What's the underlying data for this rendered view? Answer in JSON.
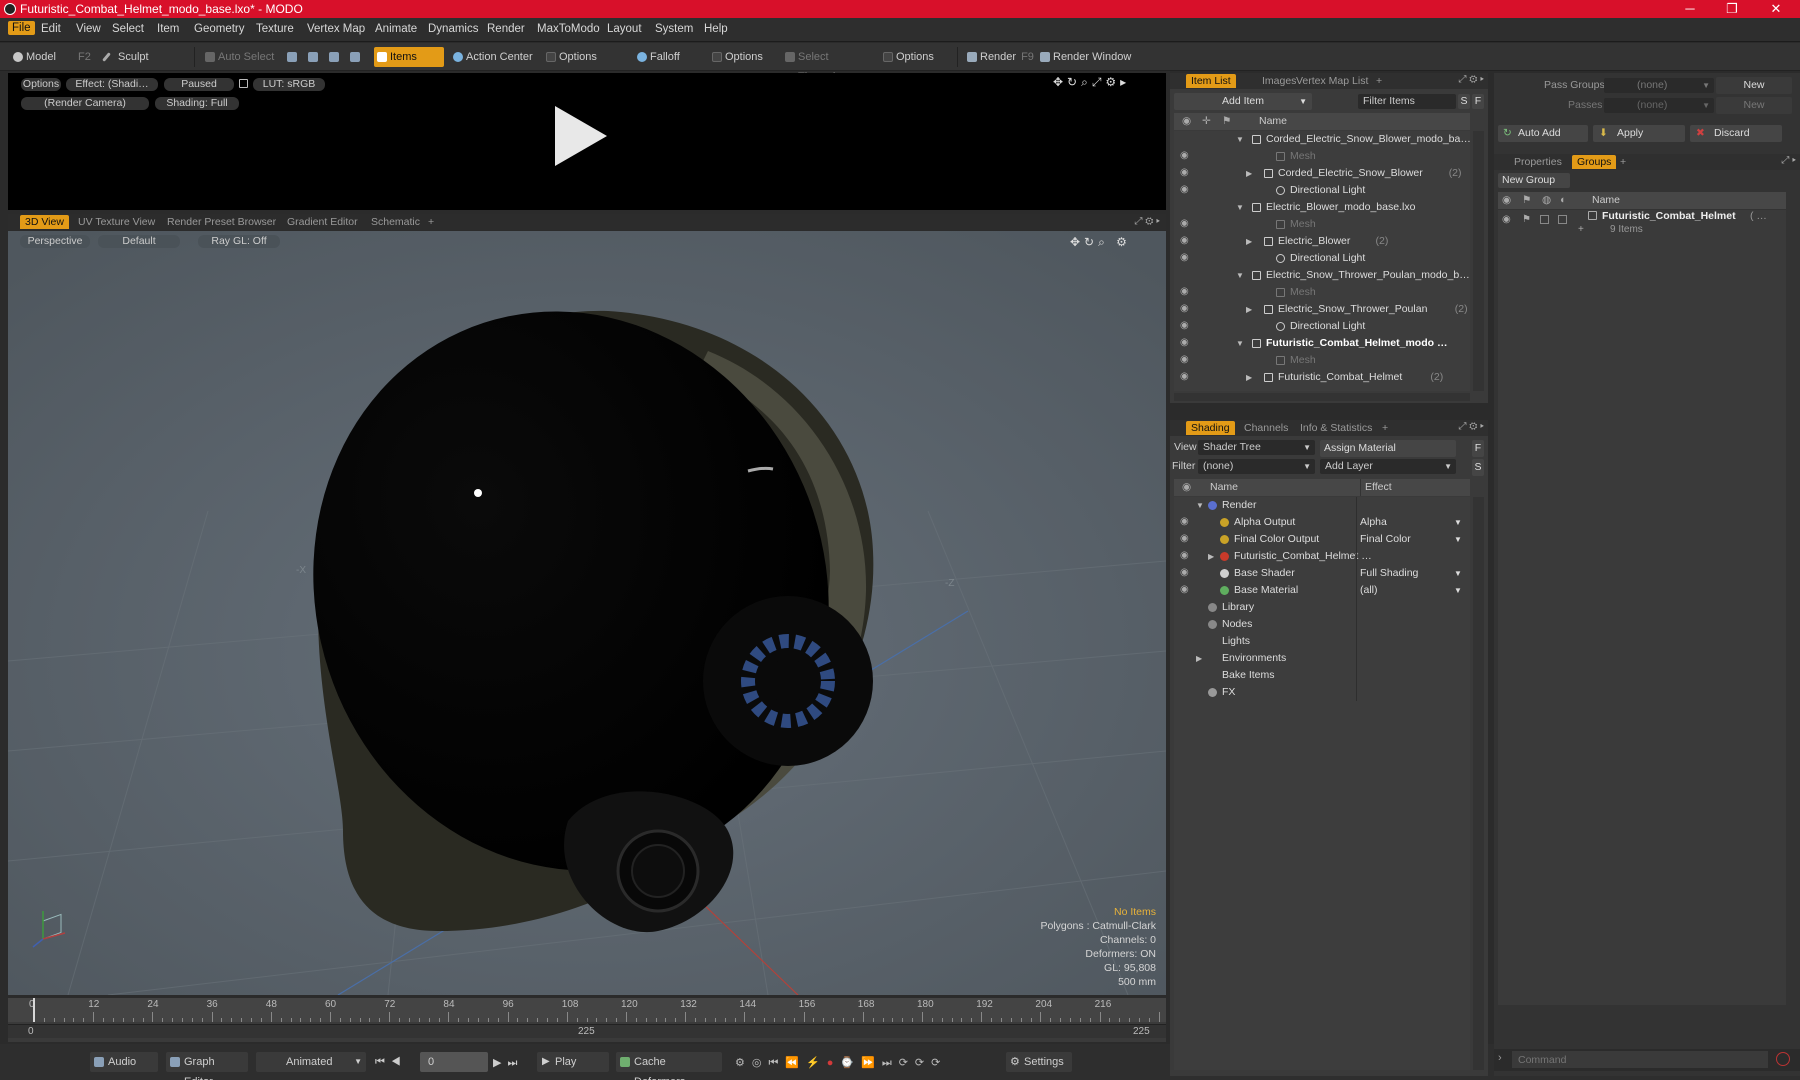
{
  "window": {
    "title": "Futuristic_Combat_Helmet_modo_base.lxo* - MODO",
    "minimize": "─",
    "maximize": "❐",
    "close": "✕"
  },
  "menu": [
    "File",
    "Edit",
    "View",
    "Select",
    "Item",
    "Geometry",
    "Texture",
    "Vertex Map",
    "Animate",
    "Dynamics",
    "Render",
    "MaxToModo",
    "Layout",
    "System",
    "Help"
  ],
  "toolbar": {
    "model": "Model",
    "model_key": "F2",
    "sculpt": "Sculpt",
    "auto_select": "Auto Select",
    "items": "Items",
    "action_center": "Action Center",
    "options1": "Options",
    "falloff": "Falloff",
    "options2": "Options",
    "select_through": "Select Through",
    "options3": "Options",
    "render": "Render",
    "render_key": "F9",
    "render_window": "Render Window"
  },
  "preview": {
    "options": "Options",
    "effect": "Effect: (Shadi…",
    "paused": "Paused",
    "lut": "LUT: sRGB",
    "camera": "(Render Camera)",
    "shading": "Shading: Full"
  },
  "viewtabs": [
    "3D View",
    "UV Texture View",
    "Render Preset Browser",
    "Gradient Editor",
    "Schematic",
    "+"
  ],
  "viewport": {
    "perspective": "Perspective",
    "default": "Default",
    "raygl": "Ray GL: Off",
    "axis_neg_x": "-X",
    "axis_neg_z": "-Z",
    "hud": {
      "no_items": "No Items",
      "polygons": "Polygons : Catmull-Clark",
      "channels": "Channels: 0",
      "deformers": "Deformers: ON",
      "gl": "GL: 95,808",
      "scale": "500 mm"
    }
  },
  "timeline": {
    "labels": [
      "0",
      "12",
      "24",
      "36",
      "48",
      "60",
      "72",
      "84",
      "96",
      "108",
      "120",
      "132",
      "144",
      "156",
      "168",
      "180",
      "192",
      "204",
      "216"
    ],
    "range_start": "0",
    "range_mid": "225",
    "range_end": "225"
  },
  "bottom": {
    "audio": "Audio",
    "graph_editor": "Graph Editor",
    "animated": "Animated",
    "frame": "0",
    "play": "Play",
    "cache_deformers": "Cache Deformers",
    "settings": "Settings"
  },
  "itemlist": {
    "tabs": [
      "Item List",
      "Images",
      "Vertex Map List",
      "+"
    ],
    "add_item": "Add Item",
    "filter": "Filter Items",
    "col_name": "Name",
    "s": "S",
    "f": "F",
    "rows": [
      {
        "label": "Corded_Electric_Snow_Blower_modo_ba…",
        "indent": 0,
        "type": "scene",
        "arrow": "▼",
        "bold": false,
        "dim": false,
        "count": ""
      },
      {
        "label": "Mesh",
        "indent": 2,
        "type": "mesh",
        "arrow": "",
        "bold": false,
        "dim": true,
        "count": ""
      },
      {
        "label": "Corded_Electric_Snow_Blower",
        "indent": 1,
        "type": "group",
        "arrow": "▶",
        "bold": false,
        "dim": false,
        "count": "(2)"
      },
      {
        "label": "Directional Light",
        "indent": 2,
        "type": "light",
        "arrow": "",
        "bold": false,
        "dim": false,
        "count": ""
      },
      {
        "label": "Electric_Blower_modo_base.lxo",
        "indent": 0,
        "type": "scene",
        "arrow": "▼",
        "bold": false,
        "dim": false,
        "count": ""
      },
      {
        "label": "Mesh",
        "indent": 2,
        "type": "mesh",
        "arrow": "",
        "bold": false,
        "dim": true,
        "count": ""
      },
      {
        "label": "Electric_Blower",
        "indent": 1,
        "type": "group",
        "arrow": "▶",
        "bold": false,
        "dim": false,
        "count": "(2)"
      },
      {
        "label": "Directional Light",
        "indent": 2,
        "type": "light",
        "arrow": "",
        "bold": false,
        "dim": false,
        "count": ""
      },
      {
        "label": "Electric_Snow_Thrower_Poulan_modo_b…",
        "indent": 0,
        "type": "scene",
        "arrow": "▼",
        "bold": false,
        "dim": false,
        "count": ""
      },
      {
        "label": "Mesh",
        "indent": 2,
        "type": "mesh",
        "arrow": "",
        "bold": false,
        "dim": true,
        "count": ""
      },
      {
        "label": "Electric_Snow_Thrower_Poulan",
        "indent": 1,
        "type": "group",
        "arrow": "▶",
        "bold": false,
        "dim": false,
        "count": "(2)"
      },
      {
        "label": "Directional Light",
        "indent": 2,
        "type": "light",
        "arrow": "",
        "bold": false,
        "dim": false,
        "count": ""
      },
      {
        "label": "Futuristic_Combat_Helmet_modo …",
        "indent": 0,
        "type": "scene",
        "arrow": "▼",
        "bold": true,
        "dim": false,
        "count": ""
      },
      {
        "label": "Mesh",
        "indent": 2,
        "type": "mesh",
        "arrow": "",
        "bold": false,
        "dim": true,
        "count": ""
      },
      {
        "label": "Futuristic_Combat_Helmet",
        "indent": 1,
        "type": "group",
        "arrow": "▶",
        "bold": false,
        "dim": false,
        "count": "(2)"
      }
    ]
  },
  "shading": {
    "tabs": [
      "Shading",
      "Channels",
      "Info & Statistics",
      "+"
    ],
    "view_label": "View",
    "view_value": "Shader Tree",
    "assign_material": "Assign Material",
    "filter_label": "Filter",
    "filter_value": "(none)",
    "add_layer": "Add Layer",
    "col_name": "Name",
    "col_effect": "Effect",
    "f": "F",
    "s": "S",
    "rows": [
      {
        "label": "Render",
        "effect": "",
        "indent": 0,
        "arrow": "▼",
        "color": "#5a6fd0",
        "eye": false
      },
      {
        "label": "Alpha Output",
        "effect": "Alpha",
        "indent": 1,
        "arrow": "",
        "color": "#c9a227",
        "eye": true
      },
      {
        "label": "Final Color Output",
        "effect": "Final Color",
        "indent": 1,
        "arrow": "",
        "color": "#c9a227",
        "eye": true
      },
      {
        "label": "Futuristic_Combat_Helmet …",
        "effect": "",
        "indent": 1,
        "arrow": "▶",
        "color": "#c83a2a",
        "eye": true
      },
      {
        "label": "Base Shader",
        "effect": "Full Shading",
        "indent": 1,
        "arrow": "",
        "color": "#cfcfcf",
        "eye": true
      },
      {
        "label": "Base Material",
        "effect": "(all)",
        "indent": 1,
        "arrow": "",
        "color": "#5fae5f",
        "eye": true
      },
      {
        "label": "Library",
        "effect": "",
        "indent": 0,
        "arrow": "",
        "color": "#888",
        "eye": false
      },
      {
        "label": "Nodes",
        "effect": "",
        "indent": 0,
        "arrow": "",
        "color": "#888",
        "eye": false
      },
      {
        "label": "Lights",
        "effect": "",
        "indent": 0,
        "arrow": "",
        "color": "",
        "eye": false
      },
      {
        "label": "Environments",
        "effect": "",
        "indent": 0,
        "arrow": "▶",
        "color": "",
        "eye": false
      },
      {
        "label": "Bake Items",
        "effect": "",
        "indent": 0,
        "arrow": "",
        "color": "",
        "eye": false
      },
      {
        "label": "FX",
        "effect": "",
        "indent": 0,
        "arrow": "",
        "color": "#999",
        "eye": false
      }
    ]
  },
  "groups": {
    "pass_groups": "Pass Groups",
    "passes": "Passes",
    "none": "(none)",
    "new": "New",
    "auto_add": "Auto Add",
    "apply": "Apply",
    "discard": "Discard",
    "tabs": [
      "Properties",
      "Groups",
      "+"
    ],
    "new_group": "New Group",
    "col_name": "Name",
    "item_name": "Futuristic_Combat_Helmet",
    "item_extra": "( …",
    "item_count": "9 Items"
  },
  "command": {
    "placeholder": "Command"
  }
}
